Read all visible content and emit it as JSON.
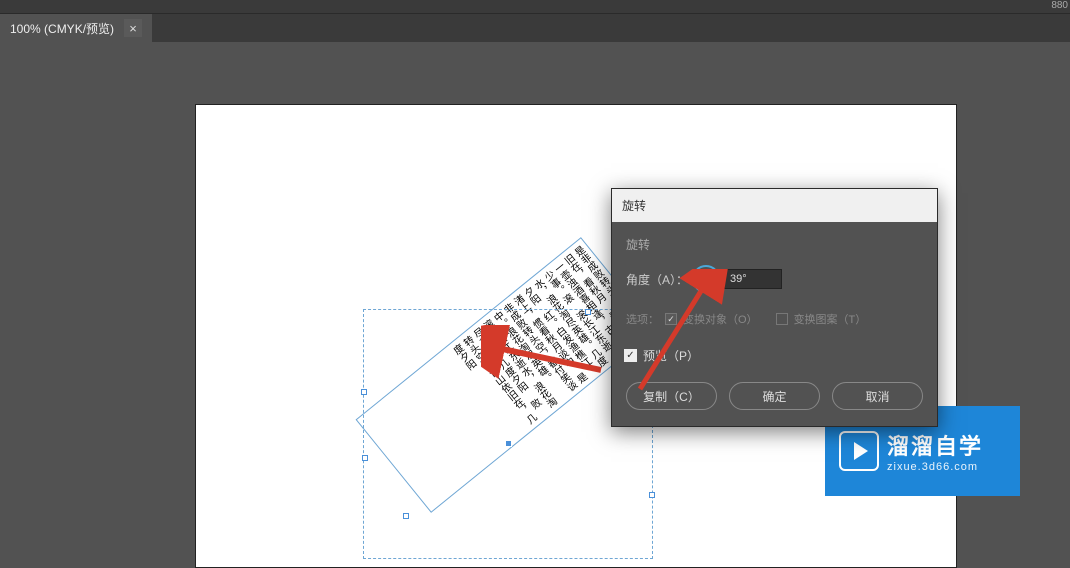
{
  "doc_tab": {
    "label": "100% (CMYK/预览)"
  },
  "right_num": "880",
  "artboard_text": "是非成败转头空，青山依旧在，看秋月\n春风。一壶浊酒喜相逢，古今多少事。滚\n滚长江东逝水，浪花淘尽英雄。几度夕阳\n红。白发渔樵江渚上，惯看秋月谈中。是\n非成败转头空，都付笑谈中。浪花淘尽英雄。\n滚滚长江东逝水，浪花淘尽英雄。几度夕阳\n败转头空，青山依旧在，几度夕阳",
  "dialog": {
    "title": "旋转",
    "section_label": "旋转",
    "angle_label": "角度（A）：",
    "angle_value": "39°",
    "options_label": "选项：",
    "transform_objects_label": "变换对象（O）",
    "transform_patterns_label": "变换图案（T）",
    "preview_label": "预览（P）",
    "btn_copy": "复制（C）",
    "btn_ok": "确定",
    "btn_cancel": "取消"
  },
  "watermark": {
    "title": "溜溜自学",
    "url": "zixue.3d66.com"
  }
}
